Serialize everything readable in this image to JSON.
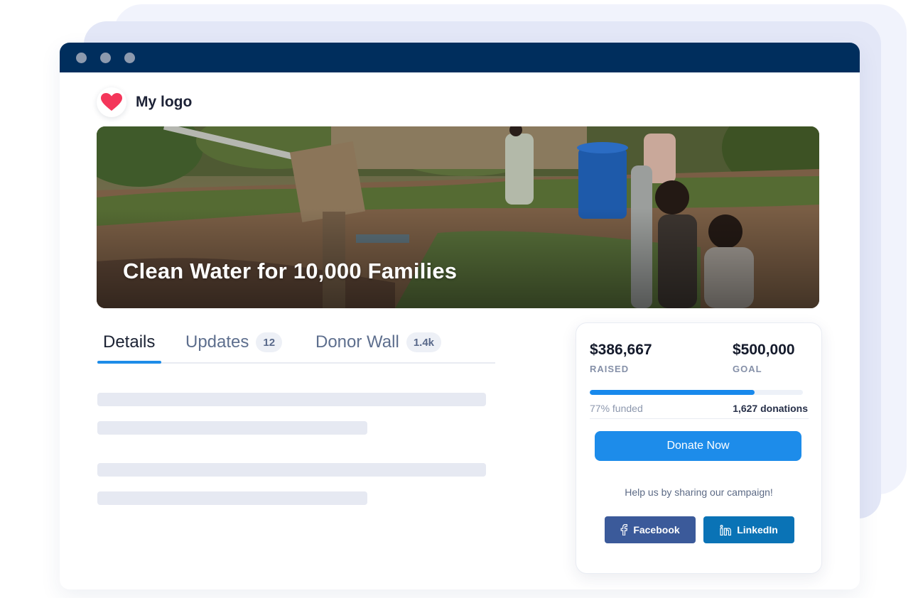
{
  "brand": {
    "logo_text": "My logo",
    "heart_color": "#f4365a"
  },
  "colors": {
    "titlebar": "#002e5d",
    "accent": "#1d8cea",
    "facebook": "#3b5a9a",
    "linkedin": "#0a73b6"
  },
  "hero": {
    "title": "Clean Water for 10,000 Families"
  },
  "tabs": [
    {
      "label": "Details",
      "count": "",
      "active": true
    },
    {
      "label": "Updates",
      "count": "12",
      "active": false
    },
    {
      "label": "Donor Wall",
      "count": "1.4k",
      "active": false
    }
  ],
  "campaign": {
    "raised_amount": "$386,667",
    "raised_label": "RAISED",
    "goal_amount": "$500,000",
    "goal_label": "GOAL",
    "progress_fraction": 0.7733,
    "funded_text": "77% funded",
    "donations_text": "1,627 donations",
    "donate_label": "Donate Now",
    "share_text": "Help us by sharing our campaign!",
    "share_buttons": [
      {
        "label": "Facebook",
        "icon": "facebook-icon"
      },
      {
        "label": "LinkedIn",
        "icon": "linkedin-icon"
      }
    ]
  }
}
